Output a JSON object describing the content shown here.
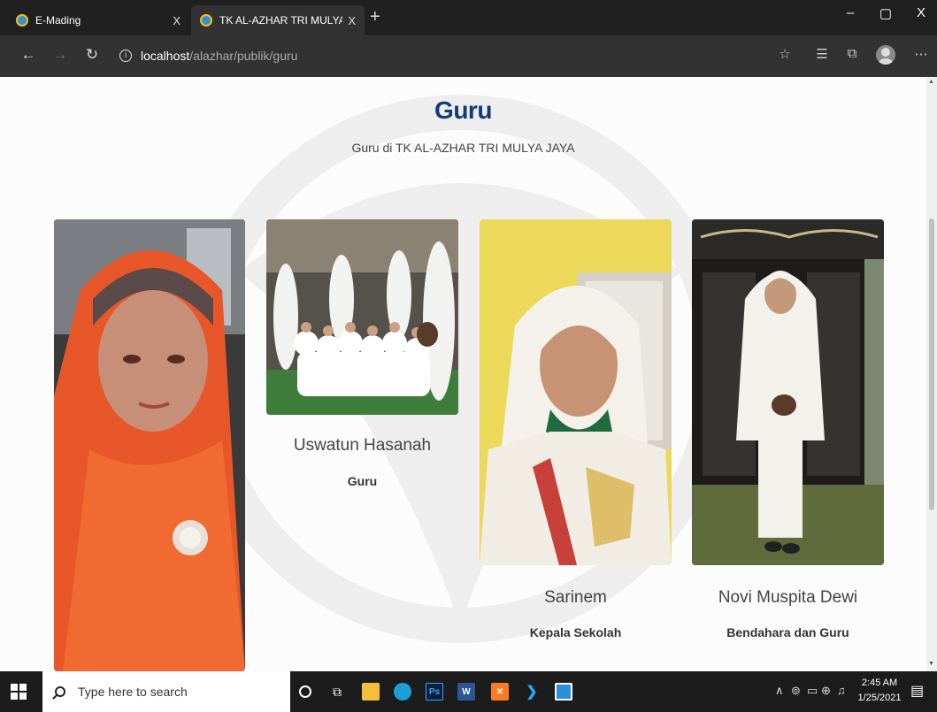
{
  "browser": {
    "tabs": [
      {
        "title": "E-Mading",
        "active": false
      },
      {
        "title": "TK AL-AZHAR TRI MULYA JAYA",
        "active": true
      }
    ],
    "tab_close_glyph": "X",
    "new_tab_glyph": "+",
    "window_controls": {
      "minimize": "–",
      "maximize": "▢",
      "close": "X"
    },
    "url_host": "localhost",
    "url_path": "/alazhar/publik/guru",
    "icons": [
      "back-icon",
      "forward-icon",
      "refresh-icon",
      "info-icon",
      "favorite-star-icon",
      "favorites-list-icon",
      "collections-icon",
      "profile-icon",
      "more-icon"
    ]
  },
  "page": {
    "title": "Guru",
    "subtitle": "Guru di TK AL-AZHAR TRI MULYA JAYA"
  },
  "teachers": [
    {
      "name": "",
      "role": "",
      "photo": "woman-orange-hijab-photo"
    },
    {
      "name": "Uswatun Hasanah",
      "role": "Guru",
      "photo": "group-photo-children-white-robes"
    },
    {
      "name": "Sarinem",
      "role": "Kepala Sekolah",
      "photo": "woman-white-hijab-selfie"
    },
    {
      "name": "Novi Muspita Dewi",
      "role": "Bendahara dan Guru",
      "photo": "woman-white-hijab-kaaba-replica"
    }
  ],
  "taskbar": {
    "search_placeholder": "Type here to search",
    "time": "2:45 AM",
    "date": "1/25/2021",
    "apps": [
      "cortana-icon",
      "task-view-icon",
      "file-explorer-icon",
      "edge-icon",
      "photoshop-icon",
      "word-icon",
      "xampp-icon",
      "vscode-icon",
      "image-viewer-icon"
    ],
    "colors": {
      "accent_heading": "#123c78",
      "taskbar_bg": "#1c1c1c"
    }
  }
}
